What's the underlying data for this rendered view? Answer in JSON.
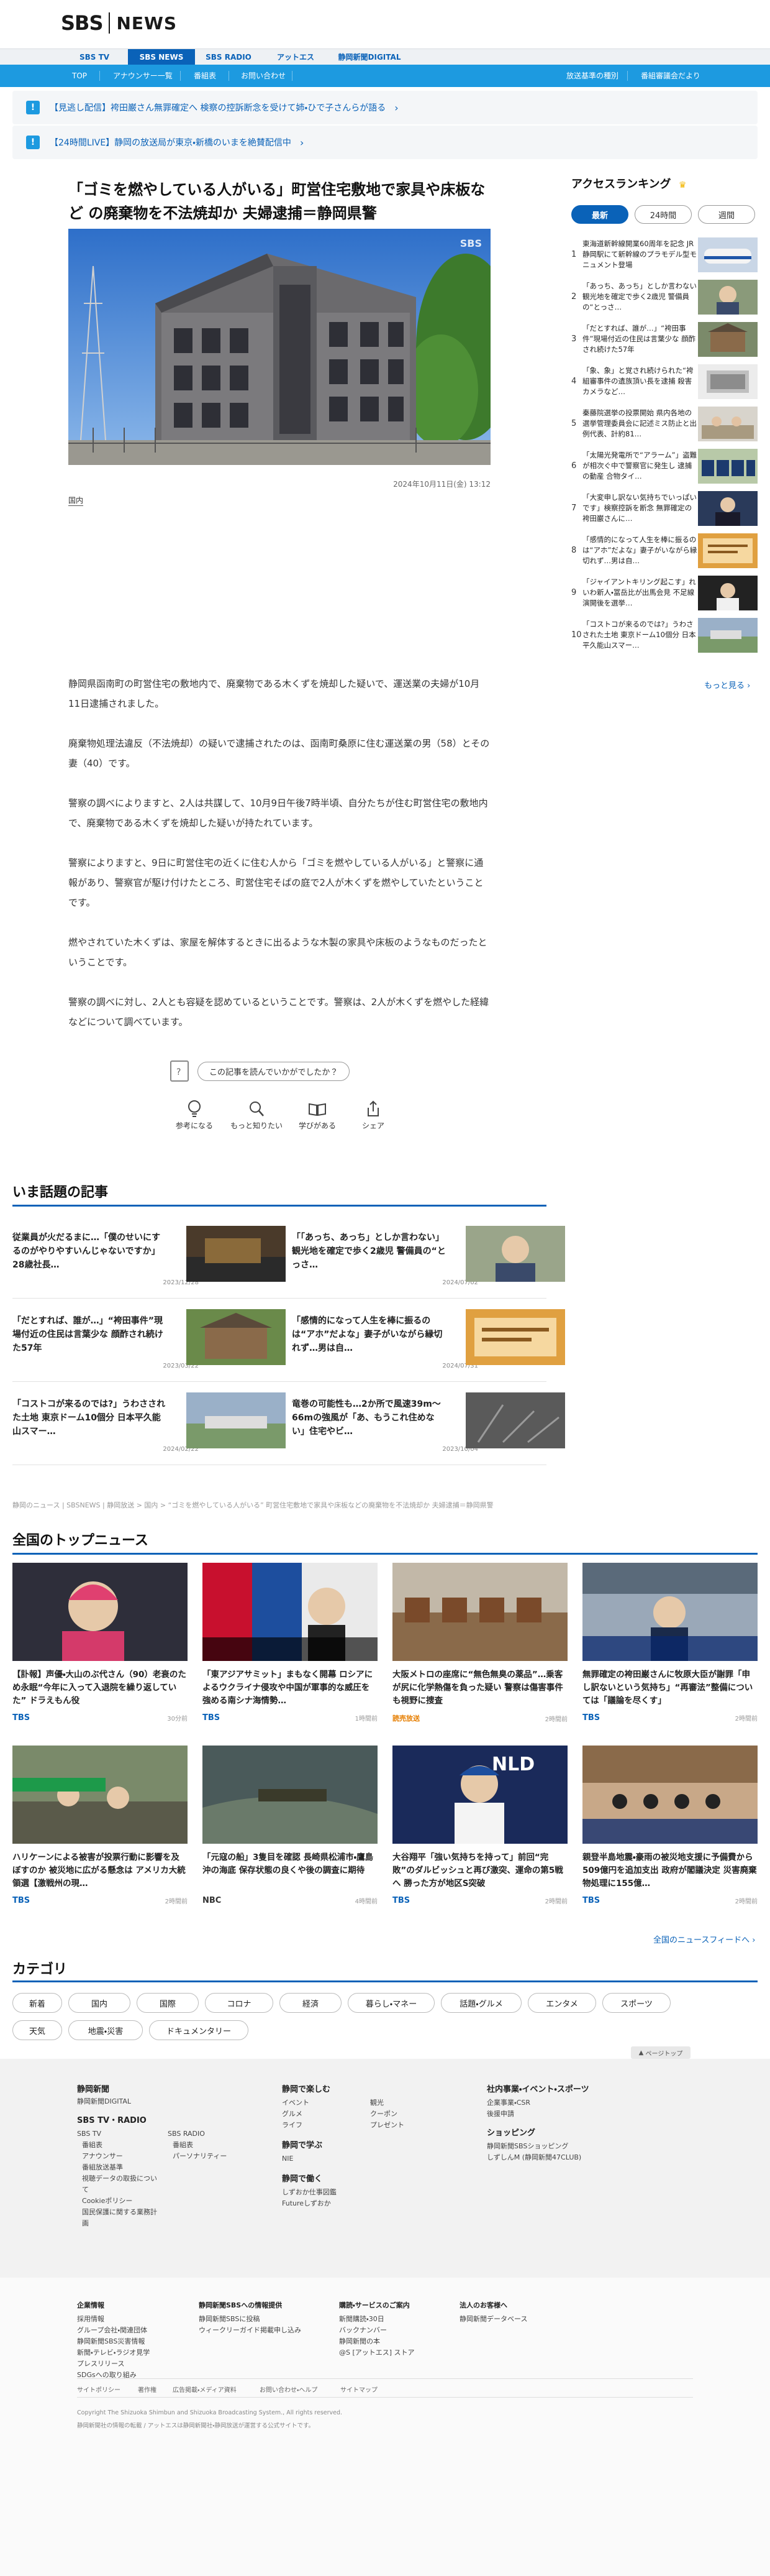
{
  "header": {
    "logo_sbs": "SBS",
    "logo_news": "NEWS",
    "channels": [
      "SBS TV",
      "SBS NEWS",
      "SBS RADIO",
      "アットエス",
      "静岡新聞DIGITAL"
    ],
    "subnav": [
      "TOP",
      "アナウンサー一覧",
      "番組表",
      "お問い合わせ",
      "放送基準の種別",
      "番組審議会だより"
    ]
  },
  "alerts": [
    {
      "text": "【見逃し配信】袴田巌さん無罪確定へ 検察の控訴断念を受けて姉・ひで子さんらが語る"
    },
    {
      "text": "【24時間LIVE】静岡の放送局が東京・新橋のいまを絶賛配信中"
    }
  ],
  "article": {
    "title": "「ゴミを燃やしている人がいる」町営住宅敷地で家具や床板など の廃棄物を不法焼却か 夫婦逮捕＝静岡県警",
    "photo_badge": "SBS",
    "date": "2024年10月11日(金) 13:12",
    "category": "国内",
    "paragraphs": [
      "静岡県函南町の町営住宅の敷地内で、廃棄物である木くずを焼却した疑いで、運送業の夫婦が10月11日逮捕されました。",
      "廃棄物処理法違反（不法焼却）の疑いで逮捕されたのは、函南町桑原に住む運送業の男（58）とその妻（40）です。",
      "警察の調べによりますと、2人は共謀して、10月9日午後7時半頃、自分たちが住む町営住宅の敷地内で、廃棄物である木くずを焼却した疑いが持たれています。",
      "警察によりますと、9日に町営住宅の近くに住む人から「ゴミを燃やしている人がいる」と警察に通報があり、警察官が駆け付けたところ、町営住宅そばの庭で2人が木くずを燃やしていたということです。",
      "燃やされていた木くずは、家屋を解体するときに出るような木製の家具や床板のようなものだったということです。",
      "警察の調べに対し、2人とも容疑を認めているということです。警察は、2人が木くずを燃やした経緯などについて調べています。"
    ],
    "reaction_question": "この記事を読んでいかがでしたか？",
    "reactions": [
      "参考になる",
      "もっと知りたい",
      "学びがある",
      "シェア"
    ]
  },
  "ranking": {
    "title": "アクセスランキング",
    "tabs": [
      "最新",
      "24時間",
      "週間"
    ],
    "items": [
      {
        "num": "1",
        "text": "東海道新幹線開業60周年を記念 JR静岡駅にて新幹線のプラモデル型モニュメント登場"
      },
      {
        "num": "2",
        "text": "「あっち、あっち」としか言わない 観光地を確定で歩く2歳児 警備員の“とっさ…"
      },
      {
        "num": "3",
        "text": "「だとすれば、誰が…」“袴田事件”現場付近の住民は言葉少な 顔酢され続けた57年"
      },
      {
        "num": "4",
        "text": "「象、象」と覚され続けられた“袴組審事件の遺族頂い長を逮捕 殺害カメラなど…"
      },
      {
        "num": "5",
        "text": "秦藤院選挙の投票開始 県内各地の選挙管理委員会に記述ミス防止と出例代表、計約81…"
      },
      {
        "num": "6",
        "text": "「太陽光発電所で“アラーム”」盗難が相次ぐ中で警察官に発生し 逮捕の動産 合物タイ…"
      },
      {
        "num": "7",
        "text": "「大変申し訳ない気持ちでいっぱいです」検察控訴を断念 無罪確定の袴田巌さんに…"
      },
      {
        "num": "8",
        "text": "「感情的になって人生を棒に振るのは“アホ”だよな」妻子がいながら縁切れず…男は自…"
      },
      {
        "num": "9",
        "text": "「ジャイアントキリング起こす」れいわ新人・冨岳比が出馬会見 不足線演開後を選挙…"
      },
      {
        "num": "10",
        "text": "「コストコが来るのでは?」うわさされた土地 東京ドーム10個分 日本平久能山スマー…"
      }
    ],
    "more": "もっと見る"
  },
  "trending": {
    "title": "いま話題の記事",
    "items": [
      {
        "text": "従業員が火だるまに…「僕のせいにするのがやりやすいんじゃないですか」28歳社長…",
        "date": "2023/12/28"
      },
      {
        "text": "「「あっち、あっち」としか言わない」観光地を確定で歩く2歳児 警備員の“とっさ…",
        "date": "2024/07/02"
      },
      {
        "text": "「だとすれば、誰が…」“袴田事件”現場付近の住民は言葉少な 顔酢され続けた57年",
        "date": "2023/03/22"
      },
      {
        "text": "「感情的になって人生を棒に振るのは“アホ”だよな」妻子がいながら縁切れず…男は自…",
        "date": "2024/07/31"
      },
      {
        "text": "「コストコが来るのでは?」うわさされた土地 東京ドーム10個分 日本平久能山スマー…",
        "date": "2024/02/22"
      },
      {
        "text": "竜巻の可能性も…2か所で風速39m〜66mの強風が「あ、もうこれ住めない」住宅やビ…",
        "date": "2023/10/04"
      }
    ]
  },
  "breadcrumb": "静岡のニュース | SBSNEWS | 静岡放送 > 国内 > “ゴミを燃やしている人がいる” 町営住宅敷地で家具や床板などの廃棄物を不法焼却か 夫婦逮捕＝静岡県警",
  "topnews": {
    "title": "全国のトップニュース",
    "items": [
      {
        "text": "【訃報】声優・大山のぶ代さん（90）老衰のため永眠“今年に入って入退院を繰り返していた” ドラえもん役",
        "src": "TBS",
        "time": "30分前"
      },
      {
        "text": "「東アジアサミット」まもなく開幕 ロシアによるウクライナ侵攻や中国が軍事的な威圧を強める南シナ海情勢…",
        "src": "TBS",
        "time": "1時間前"
      },
      {
        "text": "大阪メトロの座席に“無色無臭の薬品”…乗客が尻に化学熱傷を負った疑い 警察は傷害事件も視野に捜査",
        "src": "読売放送",
        "time": "2時間前"
      },
      {
        "text": "無罪確定の袴田巌さんに牧原大臣が謝罪「申し訳ないという気持ち」“再審法”整備については「議論を尽くす」",
        "src": "TBS",
        "time": "2時間前"
      },
      {
        "text": "ハリケーンによる被害が投票行動に影響を及ぼすのか 被災地に広がる懸念は アメリカ大統領選【激戦州の現…",
        "src": "TBS",
        "time": "2時間前"
      },
      {
        "text": "「元寇の船」3隻目を確認 長崎県松浦市・鷹島沖の海底 保存状態の良くや後の調査に期待",
        "src": "NBC",
        "time": "4時間前"
      },
      {
        "text": "大谷翔平「強い気持ちを持って」前回“完敗”のダルビッシュと再び激突、運命の第5戦へ 勝った方が地区S突破",
        "src": "TBS",
        "time": "2時間前"
      },
      {
        "text": "親登半島地震・豪雨の被災地支援に予備費から509億円を追加支出 政府が閣議決定 災害廃棄物処理に155億…",
        "src": "TBS",
        "time": "2時間前"
      }
    ],
    "more": "全国のニュースフィードへ"
  },
  "categories": {
    "title": "カテゴリ",
    "row1": [
      "新着",
      "国内",
      "国際",
      "コロナ",
      "経済",
      "暮らし・マネー",
      "話題・グルメ",
      "エンタメ",
      "スポーツ"
    ],
    "row2": [
      "天気",
      "地震・災害",
      "ドキュメンタリー"
    ]
  },
  "pagetop": "ページトップ",
  "footer": {
    "col1_head": "静岡新聞",
    "col1_link": "静岡新聞DIGITAL",
    "col1_head2": "SBS TV・RADIO",
    "col1_tv": [
      "SBS TV",
      "番組表",
      "アナウンサー",
      "番組放送基準",
      "視聴データの取扱について",
      "Cookieポリシー",
      "国民保護に関する業務計画"
    ],
    "col1_radio": [
      "SBS RADIO",
      "番組表",
      "パーソナリティー"
    ],
    "col2_head": "静岡で楽しむ",
    "col2_a": [
      "イベント",
      "グルメ",
      "ライフ"
    ],
    "col2_b": [
      "観光",
      "クーポン",
      "プレゼント"
    ],
    "col2_head2": "静岡で学ぶ",
    "col2_learn": [
      "NIE"
    ],
    "col2_head3": "静岡で働く",
    "col2_work": [
      "しずおか仕事図鑑",
      "Futureしずおか"
    ],
    "col3_head": "社内事業・イベント・スポーツ",
    "col3_links": [
      "企業事業・CSR",
      "後援申請"
    ],
    "col3_head2": "ショッピング",
    "col3_shop": [
      "静岡新聞SBSショッピング",
      "しずしんM (静岡新聞47CLUB)"
    ],
    "sub_heads": [
      "企業情報",
      "静岡新聞SBSへの情報提供",
      "購読・サービスのご案内",
      "法人のお客様へ"
    ],
    "sub_col1": [
      "採用情報",
      "グループ会社・関連団体",
      "静岡新聞SBS災害情報",
      "新聞・テレビ・ラジオ見学",
      "プレスリリース",
      "SDGsへの取り組み"
    ],
    "sub_col2": [
      "静岡新聞SBSに投稿",
      "ウィークリーガイド掲載申し込み"
    ],
    "sub_col3": [
      "新聞購読・30日",
      "バックナンバー",
      "静岡新聞の本",
      "@S [アットエス] ストア"
    ],
    "sub_col4": [
      "静岡新聞データベース"
    ],
    "bottom_links": [
      "サイトポリシー",
      "著作権",
      "広告掲載・メディア資料",
      "お問い合わせ・ヘルプ",
      "サイトマップ"
    ],
    "copyright": "Copyright The Shizuoka Shimbun and Shizuoka Broadcasting System., All rights reserved.",
    "copyright2": "静岡新聞社の情報の転載 / アットエスは静岡新聞社・静岡放送が運営する公式サイトです。"
  },
  "colors": {
    "brand": "#0a62b8",
    "accent": "#1d9ae0"
  }
}
